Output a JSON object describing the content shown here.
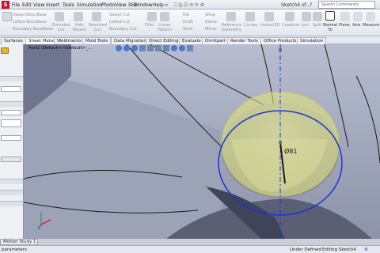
{
  "menubar": {
    "logo": "S",
    "items": [
      "File",
      "Edit",
      "View",
      "Insert",
      "Tools",
      "Simulation",
      "PhotoView 360",
      "Window",
      "Help"
    ],
    "window_title": "Sketch4 of...",
    "search_placeholder": "Search Commands"
  },
  "ribbon": {
    "swept_boss": "Swept Boss/Base",
    "lofted_boss": "Lofted Boss/Base",
    "boundary_boss": "Boundary Boss/Base",
    "extruded_cut": "Extruded Cut",
    "hole_wizard": "Hole Wizard",
    "revolved_cut": "Revolved Cut",
    "swept_cut": "Swept Cut",
    "lofted_cut": "Lofted Cut",
    "boundary_cut": "Boundary Cut",
    "fillet": "Fillet",
    "linear_pattern": "Linear Pattern",
    "rib": "Rib",
    "draft": "Draft",
    "shell": "Shell",
    "wrap": "Wrap",
    "dome": "Dome",
    "mirror": "Mirror",
    "reference_geometry": "Reference Geometry",
    "curves": "Curves",
    "instant3d": "Instant3D",
    "combine": "Combine",
    "join": "Join",
    "split": "Split",
    "normal_to": "Normal To",
    "plane": "Plane",
    "axis": "Axis",
    "measure": "Measure"
  },
  "tabs": [
    "Surfaces",
    "Sheet Metal",
    "Weldments",
    "Mold Tools",
    "Data Migration",
    "Direct Editing",
    "Evaluate",
    "DimXpert",
    "Render Tools",
    "Office Products",
    "Simulation"
  ],
  "viewport": {
    "breadcrumb": "Part2  (Default<<Default>_...",
    "dimension_label": "Ø81"
  },
  "bottom": {
    "motion_tab": "Motion Study 1",
    "status_left": "parameters",
    "status_mid": "Under Defined",
    "status_right": "Editing Sketch4"
  },
  "colors": {
    "accent_blue": "#1a33d6",
    "highlight_yellow": "#e6e77a"
  }
}
